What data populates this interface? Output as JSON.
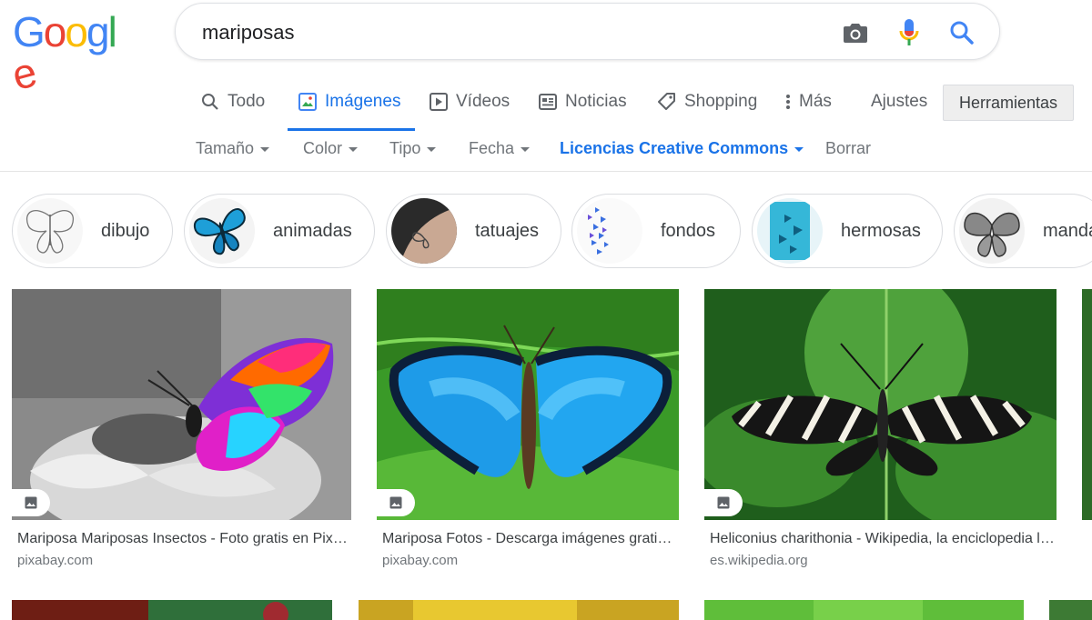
{
  "colors": {
    "accent": "#1a73e8",
    "google_blue": "#4285f4",
    "google_red": "#ea4335",
    "google_yellow": "#fbbc05",
    "google_green": "#34a853"
  },
  "logo": {
    "letters": [
      "G",
      "o",
      "o",
      "g",
      "l",
      "e"
    ]
  },
  "search": {
    "query": "mariposas",
    "icons": [
      "camera-icon",
      "mic-icon",
      "search-icon"
    ]
  },
  "tabs": [
    {
      "label": "Todo",
      "icon": "search-icon"
    },
    {
      "label": "Imágenes",
      "icon": "image-icon",
      "active": true
    },
    {
      "label": "Vídeos",
      "icon": "play-icon"
    },
    {
      "label": "Noticias",
      "icon": "news-icon"
    },
    {
      "label": "Shopping",
      "icon": "tag-icon"
    },
    {
      "label": "Más",
      "icon": "more-vert-icon"
    }
  ],
  "settings_label": "Ajustes",
  "tools_label": "Herramientas",
  "filters": [
    {
      "label": "Tamaño"
    },
    {
      "label": "Color"
    },
    {
      "label": "Tipo"
    },
    {
      "label": "Fecha"
    },
    {
      "label": "Licencias Creative Commons",
      "active": true
    },
    {
      "label": "Borrar"
    }
  ],
  "chips": [
    {
      "label": "dibujo"
    },
    {
      "label": "animadas"
    },
    {
      "label": "tatuajes"
    },
    {
      "label": "fondos"
    },
    {
      "label": "hermosas"
    },
    {
      "label": "manda"
    }
  ],
  "results": [
    {
      "title": "Mariposa Mariposas Insectos - Foto gratis en Pixabay",
      "source": "pixabay.com"
    },
    {
      "title": "Mariposa Fotos - Descarga imágenes gratis - Pixabay",
      "source": "pixabay.com"
    },
    {
      "title": "Heliconius charithonia - Wikipedia, la enciclopedia libre",
      "source": "es.wikipedia.org"
    }
  ]
}
